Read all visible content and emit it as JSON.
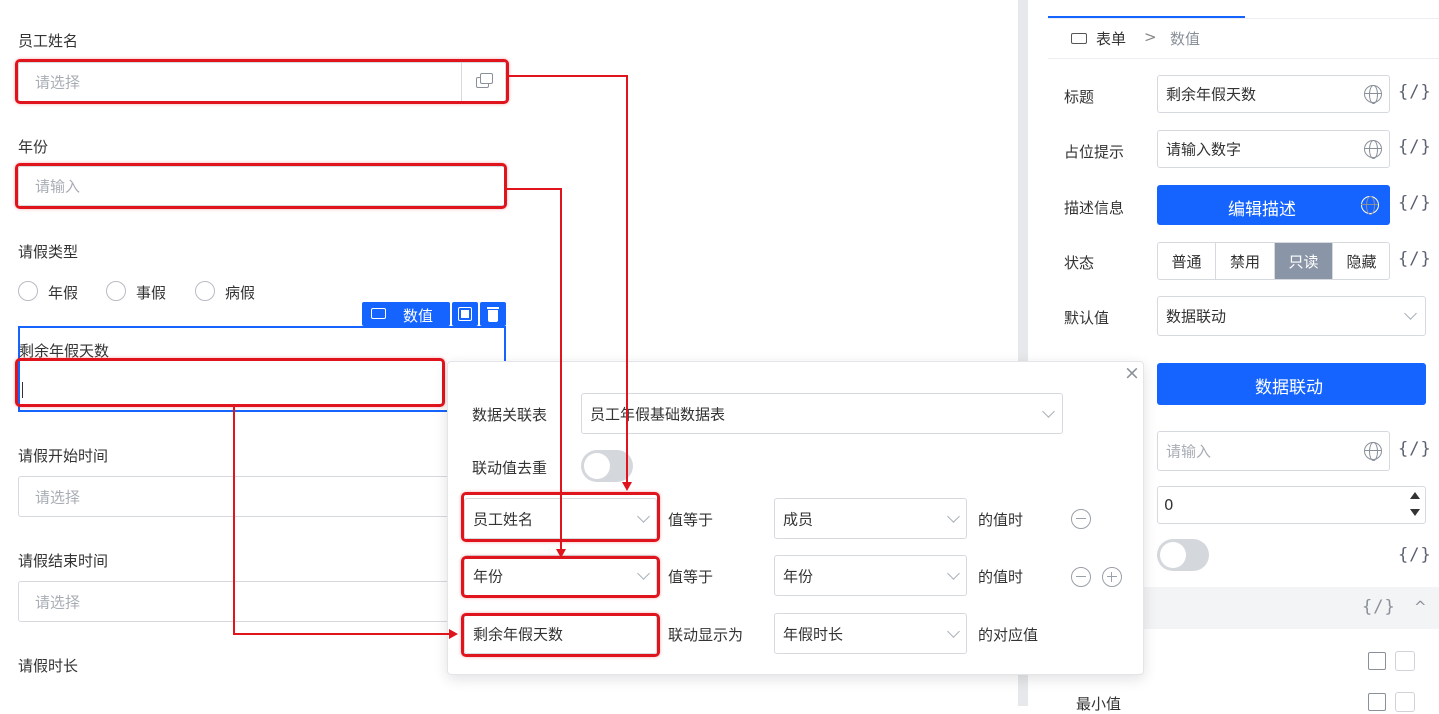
{
  "form": {
    "employee_name": {
      "label": "员工姓名",
      "placeholder": "请选择"
    },
    "year": {
      "label": "年份",
      "placeholder": "请输入"
    },
    "leave_type": {
      "label": "请假类型",
      "options": [
        "年假",
        "事假",
        "病假"
      ]
    },
    "selected_widget": {
      "tag": "数值",
      "label": "剩余年假天数"
    },
    "start_time": {
      "label": "请假开始时间",
      "placeholder": "请选择"
    },
    "end_time": {
      "label": "请假结束时间",
      "placeholder": "请选择"
    },
    "duration": {
      "label": "请假时长"
    }
  },
  "popup": {
    "table_label": "数据关联表",
    "table_value": "员工年假基础数据表",
    "dedupe_label": "联动值去重",
    "rules": [
      {
        "field": "员工姓名",
        "op": "值等于",
        "target": "成员",
        "suffix": "的值时"
      },
      {
        "field": "年份",
        "op": "值等于",
        "target": "年份",
        "suffix": "的值时"
      },
      {
        "field": "剩余年假天数",
        "op": "联动显示为",
        "target": "年假时长",
        "suffix": "的对应值"
      }
    ],
    "close_glyph": "×"
  },
  "panel": {
    "breadcrumb": {
      "root": "表单",
      "sep": ">",
      "current": "数值",
      "root_icon": "123"
    },
    "title_label": "标题",
    "title_value": "剩余年假天数",
    "placeholder_label": "占位提示",
    "placeholder_value": "请输入数字",
    "desc_label": "描述信息",
    "desc_button": "编辑描述",
    "state_label": "状态",
    "state_options": [
      "普通",
      "禁用",
      "只读",
      "隐藏"
    ],
    "state_selected": "只读",
    "default_label": "默认值",
    "default_value": "数据联动",
    "link_button": "数据联动",
    "extra_input_placeholder": "请输入",
    "number_value": "0",
    "code_glyph": "{/}",
    "collapse_glyph": "^",
    "min_label": "最小值"
  },
  "colors": {
    "accent": "#1664ff",
    "red": "#e0141c",
    "selected_seg": "#8a96a8"
  }
}
